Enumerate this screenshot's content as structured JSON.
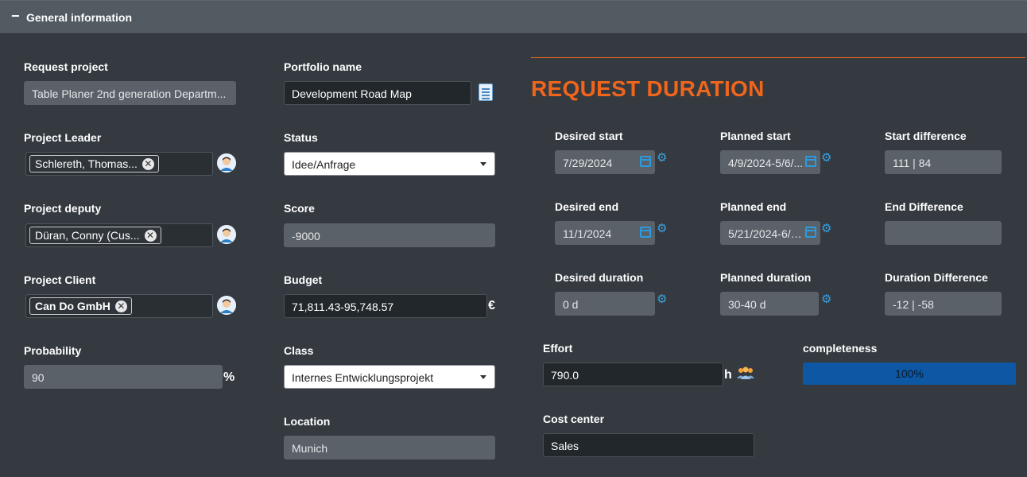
{
  "section": {
    "collapse_symbol": "−",
    "title": "General information"
  },
  "left": {
    "request_project": {
      "label": "Request project",
      "value": "Table Planer 2nd generation Departm..."
    },
    "project_leader": {
      "label": "Project Leader",
      "tag": "Schlereth, Thomas..."
    },
    "project_deputy": {
      "label": "Project deputy",
      "tag": "Düran, Conny (Cus..."
    },
    "project_client": {
      "label": "Project Client",
      "tag": "Can Do GmbH"
    },
    "probability": {
      "label": "Probability",
      "value": "90",
      "unit": "%"
    }
  },
  "middle": {
    "portfolio_name": {
      "label": "Portfolio name",
      "value": "Development Road Map"
    },
    "status": {
      "label": "Status",
      "value": "Idee/Anfrage"
    },
    "score": {
      "label": "Score",
      "value": "-9000"
    },
    "budget": {
      "label": "Budget",
      "value": "71,811.43-95,748.57",
      "unit": "€"
    },
    "class": {
      "label": "Class",
      "value": "Internes Entwicklungsprojekt"
    },
    "location": {
      "label": "Location",
      "value": "Munich"
    }
  },
  "duration": {
    "title": "REQUEST DURATION",
    "desired_start": {
      "label": "Desired start",
      "value": "7/29/2024"
    },
    "planned_start": {
      "label": "Planned start",
      "value": "4/9/2024-5/6/..."
    },
    "start_difference": {
      "label": "Start difference",
      "value": "111 | 84"
    },
    "desired_end": {
      "label": "Desired end",
      "value": "11/1/2024"
    },
    "planned_end": {
      "label": "Planned end",
      "value": "5/21/2024-6/2..."
    },
    "end_difference": {
      "label": "End Difference",
      "value": ""
    },
    "desired_duration": {
      "label": "Desired duration",
      "value": "0 d"
    },
    "planned_duration": {
      "label": "Planned duration",
      "value": "30-40 d"
    },
    "duration_difference": {
      "label": "Duration Difference",
      "value": "-12 | -58"
    }
  },
  "effort": {
    "label": "Effort",
    "value": "790.0",
    "unit": "h"
  },
  "completeness": {
    "label": "completeness",
    "value_text": "100%",
    "fraction": 1.0
  },
  "cost_center": {
    "label": "Cost center",
    "value": "Sales"
  },
  "colors": {
    "accent": "#f0651c",
    "icon_blue": "#2b9be0",
    "progress": "#0d57a4"
  },
  "icons": [
    "collapse-icon",
    "document-icon",
    "avatar-icon",
    "remove-tag-icon",
    "calendar-icon",
    "gear-icon",
    "people-icon",
    "dropdown-caret-icon"
  ]
}
